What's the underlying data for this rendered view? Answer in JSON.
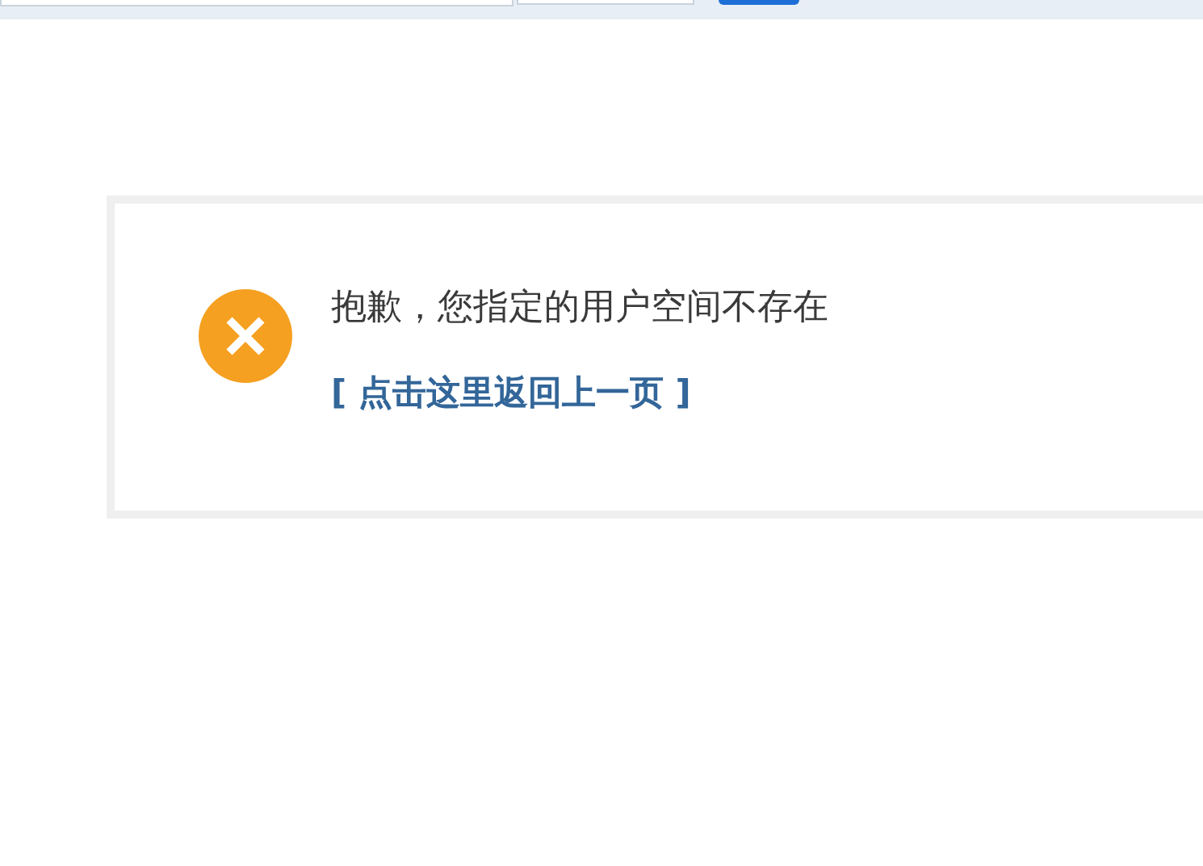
{
  "message": "抱歉，您指定的用户空间不存在",
  "back_link": "[ 点击这里返回上一页 ]"
}
